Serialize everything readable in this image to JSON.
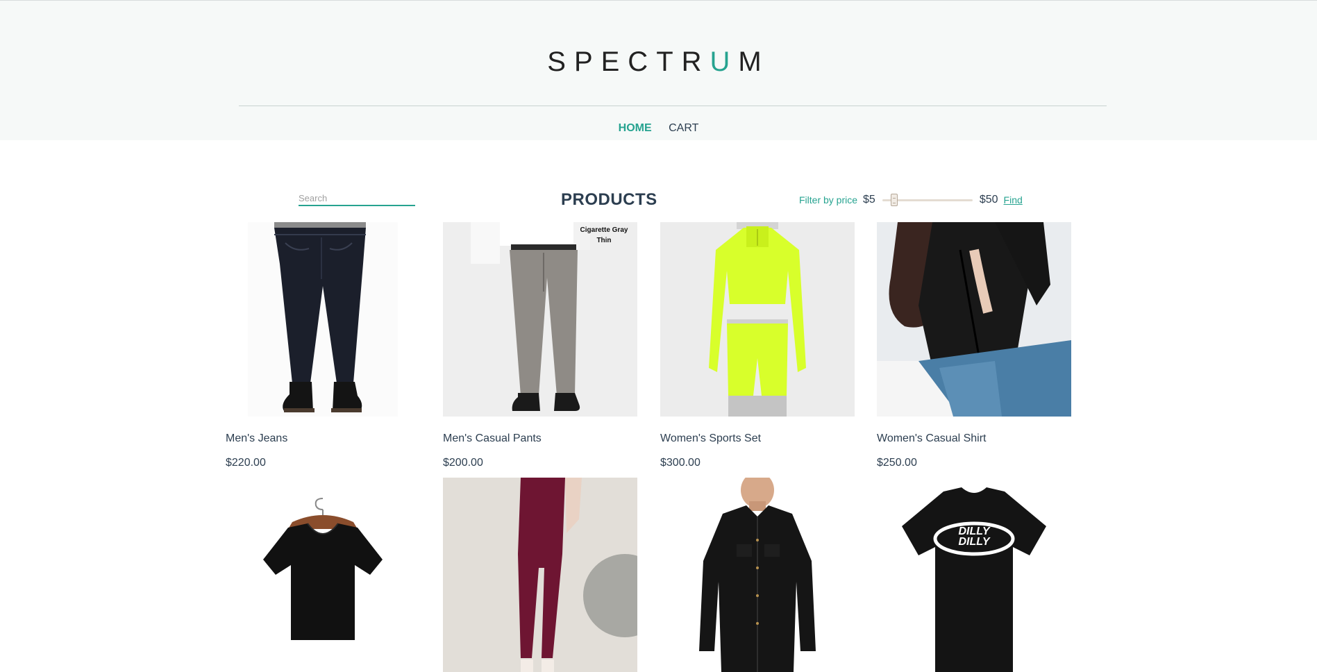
{
  "brand": {
    "prefix": "SPECTR",
    "accent": "U",
    "suffix": "M"
  },
  "nav": {
    "home": "HOME",
    "cart": "CART"
  },
  "search": {
    "placeholder": "Search",
    "value": ""
  },
  "section_title": "PRODUCTS",
  "filter": {
    "label": "Filter by price",
    "min": "$5",
    "max": "$50",
    "find": "Find",
    "slider_value_fraction": 0.1
  },
  "colors": {
    "accent": "#26a390",
    "text": "#2c3e50",
    "header_bg": "#f6f9f8"
  },
  "products": [
    {
      "name": "Men's Jeans",
      "price": "$220.00"
    },
    {
      "name": "Men's Casual Pants",
      "price": "$200.00",
      "image_text_1": "Cigarette Gray",
      "image_text_2": "Thin"
    },
    {
      "name": "Women's Sports Set",
      "price": "$300.00"
    },
    {
      "name": "Women's Casual Shirt",
      "price": "$250.00"
    },
    {
      "name": "",
      "price": ""
    },
    {
      "name": "",
      "price": ""
    },
    {
      "name": "",
      "price": ""
    },
    {
      "name": "",
      "price": "",
      "image_text_1": "DILLY",
      "image_text_2": "DILLY"
    }
  ]
}
